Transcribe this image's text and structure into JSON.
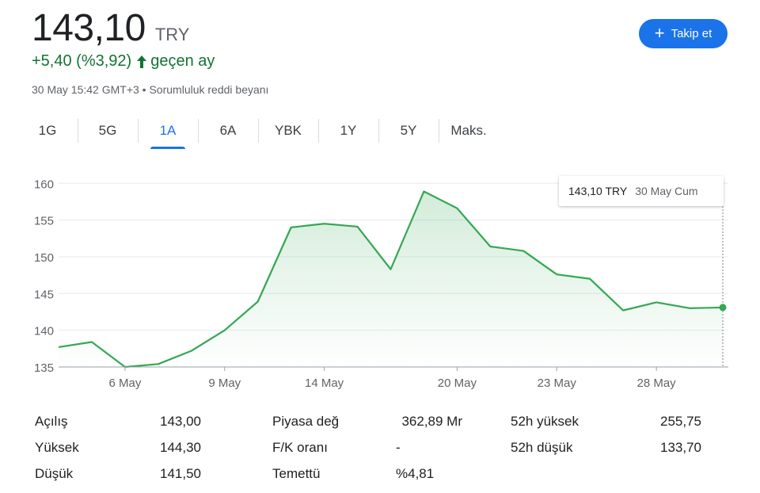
{
  "quote": {
    "price": "143,10",
    "currency": "TRY",
    "change": "+5,40 (%3,92)",
    "period": "geçen ay",
    "timestamp": "30 May 15:42 GMT+3 • Sorumluluk reddi beyanı"
  },
  "follow_button": {
    "label": "Takip et",
    "icon": "plus-icon"
  },
  "tabs": [
    {
      "label": "1G"
    },
    {
      "label": "5G"
    },
    {
      "label": "1A",
      "active": true
    },
    {
      "label": "6A"
    },
    {
      "label": "YBK"
    },
    {
      "label": "1Y"
    },
    {
      "label": "5Y"
    },
    {
      "label": "Maks."
    }
  ],
  "tooltip": {
    "price": "143,10 TRY",
    "date": "30 May Cum"
  },
  "colors": {
    "accent": "#1a73e8",
    "positive": "#137333",
    "line": "#34a853"
  },
  "chart_data": {
    "type": "area",
    "x": [
      "3 May",
      "4 May",
      "6 May",
      "7 May",
      "8 May",
      "9 May",
      "10 May",
      "13 May",
      "14 May",
      "15 May",
      "16 May",
      "17 May",
      "20 May",
      "21 May",
      "22 May",
      "23 May",
      "24 May",
      "27 May",
      "28 May",
      "29 May",
      "30 May"
    ],
    "values": [
      137.7,
      138.4,
      135.0,
      135.4,
      137.2,
      140.0,
      143.9,
      154.0,
      154.5,
      154.1,
      148.3,
      158.9,
      156.6,
      151.4,
      150.8,
      147.6,
      147.0,
      142.7,
      143.8,
      143.0,
      143.1
    ],
    "x_tick_labels": [
      "6 May",
      "9 May",
      "14 May",
      "20 May",
      "23 May",
      "28 May"
    ],
    "x_tick_indices": [
      2,
      5,
      8,
      12,
      15,
      18
    ],
    "y_ticks": [
      135,
      140,
      145,
      150,
      155,
      160
    ],
    "ylim": [
      135,
      161
    ],
    "grid": true
  },
  "stats": {
    "left": [
      {
        "label": "Açılış",
        "value": "143,00"
      },
      {
        "label": "Yüksek",
        "value": "144,30"
      },
      {
        "label": "Düşük",
        "value": "141,50"
      }
    ],
    "middle": [
      {
        "label": "Piyasa değ",
        "value": "362,89 Mr"
      },
      {
        "label": "F/K oranı",
        "value": "-"
      },
      {
        "label": "Temettü",
        "value": "%4,81"
      }
    ],
    "right": [
      {
        "label": "52h yüksek",
        "value": "255,75"
      },
      {
        "label": "52h düşük",
        "value": "133,70"
      }
    ]
  }
}
